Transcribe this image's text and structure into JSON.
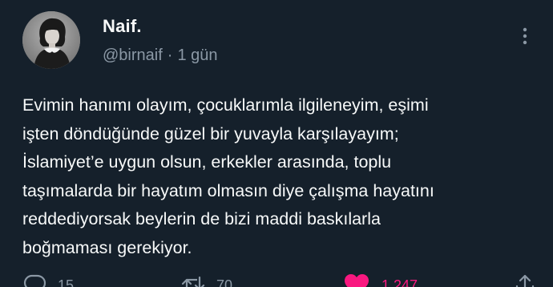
{
  "user": {
    "display_name": "Naif.",
    "handle": "@birnaif",
    "separator": "·",
    "time": "1 gün"
  },
  "tweet": {
    "lines": [
      "Evimin hanımı olayım, çocuklarımla ilgileneyim, eşimi",
      "işten döndüğünde güzel bir yuvayla karşılayayım;",
      "İslamiyet’e uygun olsun, erkekler arasında, toplu",
      "taşımalarda bir hayatım olmasın diye çalışma hayatını",
      "reddediyorsak beylerin de bizi maddi baskılarla",
      "boğmaması gerekiyor."
    ]
  },
  "actions": {
    "reply_count": "15",
    "retweet_count": "70",
    "like_count": "1.247"
  },
  "icons": {
    "avatar": "profile-photo",
    "more": "vertical-dots-icon",
    "reply": "speech-bubble-icon",
    "retweet": "retweet-arrows-icon",
    "like": "heart-icon",
    "share": "share-icon"
  },
  "colors": {
    "background": "#15202b",
    "text": "#f7f9f9",
    "secondary": "#8b98a5",
    "like": "#f91880"
  }
}
